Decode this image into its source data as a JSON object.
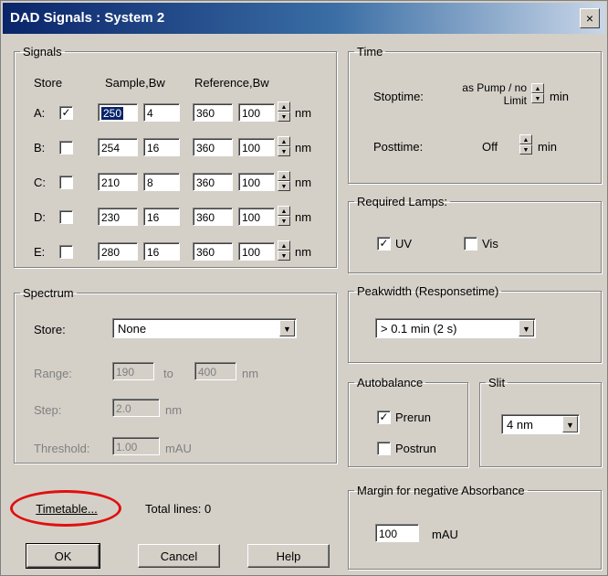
{
  "window": {
    "title": "DAD Signals : System 2",
    "close_glyph": "×"
  },
  "signals": {
    "legend": "Signals",
    "headers": {
      "store": "Store",
      "sample_bw": "Sample,Bw",
      "reference_bw": "Reference,Bw"
    },
    "rows": [
      {
        "letter": "A:",
        "checked": true,
        "check_glyph": "✓",
        "sample": "250",
        "bw": "4",
        "ref": "360",
        "ref_bw": "100",
        "unit": "nm"
      },
      {
        "letter": "B:",
        "checked": false,
        "check_glyph": "",
        "sample": "254",
        "bw": "16",
        "ref": "360",
        "ref_bw": "100",
        "unit": "nm"
      },
      {
        "letter": "C:",
        "checked": false,
        "check_glyph": "",
        "sample": "210",
        "bw": "8",
        "ref": "360",
        "ref_bw": "100",
        "unit": "nm"
      },
      {
        "letter": "D:",
        "checked": false,
        "check_glyph": "",
        "sample": "230",
        "bw": "16",
        "ref": "360",
        "ref_bw": "100",
        "unit": "nm"
      },
      {
        "letter": "E:",
        "checked": false,
        "check_glyph": "",
        "sample": "280",
        "bw": "16",
        "ref": "360",
        "ref_bw": "100",
        "unit": "nm"
      }
    ]
  },
  "time": {
    "legend": "Time",
    "stoptime_label": "Stoptime:",
    "stoptime_value": "as Pump / no Limit",
    "stoptime_unit": "min",
    "posttime_label": "Posttime:",
    "posttime_value": "Off",
    "posttime_unit": "min"
  },
  "lamps": {
    "legend": "Required Lamps:",
    "uv_label": "UV",
    "uv_checked": true,
    "uv_glyph": "✓",
    "vis_label": "Vis",
    "vis_checked": false,
    "vis_glyph": ""
  },
  "spectrum": {
    "legend": "Spectrum",
    "store_label": "Store:",
    "store_value": "None",
    "range_label": "Range:",
    "range_from": "190",
    "range_to_label": "to",
    "range_to": "400",
    "range_unit": "nm",
    "step_label": "Step:",
    "step_value": "2.0",
    "step_unit": "nm",
    "threshold_label": "Threshold:",
    "threshold_value": "1.00",
    "threshold_unit": "mAU"
  },
  "peakwidth": {
    "legend": "Peakwidth (Responsetime)",
    "value": "> 0.1 min (2 s)"
  },
  "autobalance": {
    "legend": "Autobalance",
    "prerun_label": "Prerun",
    "prerun_checked": true,
    "prerun_glyph": "✓",
    "postrun_label": "Postrun",
    "postrun_checked": false,
    "postrun_glyph": ""
  },
  "slit": {
    "legend": "Slit",
    "value": "4 nm"
  },
  "margin": {
    "legend": "Margin for negative Absorbance",
    "value": "100",
    "unit": "mAU"
  },
  "timetable": {
    "button_label": "Timetable...",
    "total_lines": "Total lines: 0"
  },
  "buttons": {
    "ok": "OK",
    "cancel": "Cancel",
    "help": "Help"
  },
  "colors": {
    "title_start": "#0a246a",
    "title_end": "#c9d6e8",
    "face": "#d4d0c8",
    "highlight_ring": "#e01010"
  },
  "icons": {
    "spin": "spin-up-down-icon",
    "dropdown": "chevron-down-icon",
    "close": "close-icon",
    "check": "check-icon"
  }
}
